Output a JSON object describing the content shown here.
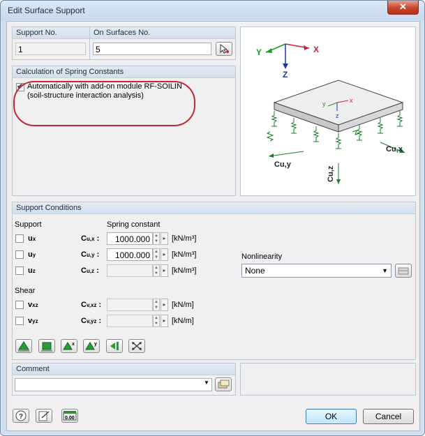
{
  "window": {
    "title": "Edit Surface Support",
    "close_glyph": "✕"
  },
  "support_no": {
    "label": "Support No.",
    "value": "1"
  },
  "on_surfaces": {
    "label": "On Surfaces No.",
    "value": "5"
  },
  "spring_calc": {
    "header": "Calculation of Spring Constants",
    "checkbox_label_line1": "Automatically with add-on module RF-SOILIN",
    "checkbox_label_line2": "(soil-structure interaction analysis)",
    "checked": true
  },
  "diagram": {
    "axis_x": "X",
    "axis_y": "Y",
    "axis_z": "Z",
    "local_x": "x",
    "local_y": "y",
    "local_z": "z",
    "cuy": "Cu,y",
    "cux": "Cu,x",
    "cuz": "Cu,z"
  },
  "support_conditions": {
    "header": "Support Conditions",
    "support_label": "Support",
    "spring_constant_label": "Spring constant",
    "rows": [
      {
        "name": "u",
        "sub": "x",
        "c": "C",
        "csub": "u,x",
        "value": "1000.000",
        "unit": "[kN/m³]",
        "checked": false,
        "enabled": true
      },
      {
        "name": "u",
        "sub": "y",
        "c": "C",
        "csub": "u,y",
        "value": "1000.000",
        "unit": "[kN/m³]",
        "checked": false,
        "enabled": true
      },
      {
        "name": "u",
        "sub": "z",
        "c": "C",
        "csub": "u,z",
        "value": "",
        "unit": "[kN/m³]",
        "checked": false,
        "enabled": false
      }
    ],
    "shear_label": "Shear",
    "shear_rows": [
      {
        "name": "v",
        "sub": "xz",
        "c": "C",
        "csub": "v,xz",
        "value": "",
        "unit": "[kN/m]"
      },
      {
        "name": "v",
        "sub": "yz",
        "c": "C",
        "csub": "v,yz",
        "value": "",
        "unit": "[kN/m]"
      }
    ],
    "nonlinearity_label": "Nonlinearity",
    "nonlinearity_value": "None"
  },
  "comment": {
    "label": "Comment",
    "value": ""
  },
  "buttons": {
    "ok": "OK",
    "cancel": "Cancel"
  },
  "icons": {
    "help": "help-icon",
    "edit": "edit-icon",
    "units": "units-icon",
    "units_text": "0.00"
  },
  "colors": {
    "accent_red": "#c0283a",
    "axis_green": "#1a9a2a",
    "axis_blue": "#1a3a9a"
  }
}
